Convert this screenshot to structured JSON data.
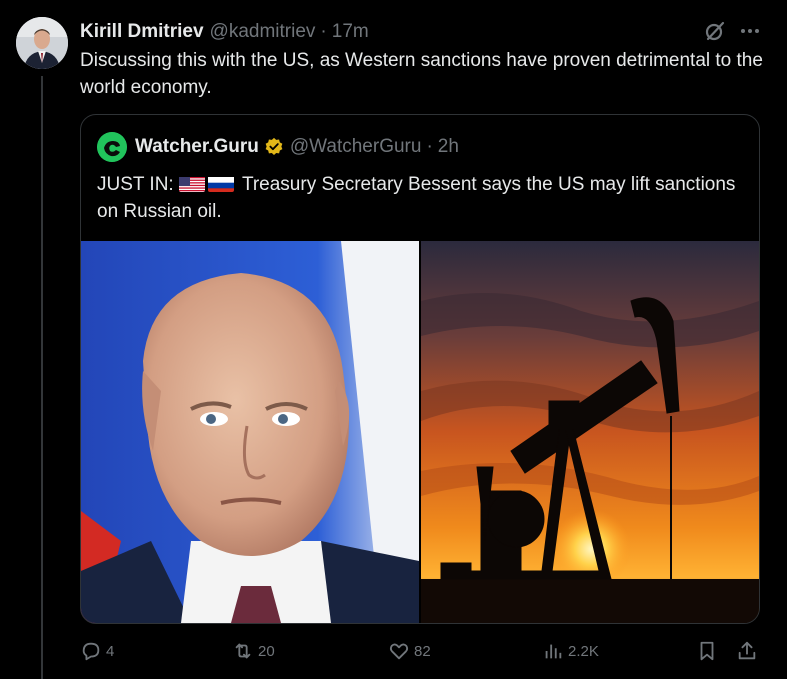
{
  "post": {
    "author_name": "Kirill Dmitriev",
    "author_handle": "@kadmitriev",
    "separator": "·",
    "time": "17m",
    "text": "Discussing this with the US, as Western sanctions have proven detrimental to the world economy."
  },
  "quote": {
    "author_name": "Watcher.Guru",
    "author_handle": "@WatcherGuru",
    "separator": "·",
    "time": "2h",
    "text_prefix": "JUST IN:",
    "text_body": "Treasury Secretary Bessent says the US may lift sanctions on Russian oil.",
    "verified_color": "#e2b719"
  },
  "actions": {
    "replies": "4",
    "reposts": "20",
    "likes": "82",
    "views": "2.2K"
  },
  "colors": {
    "background": "#000000",
    "text": "#e7e9ea",
    "secondary": "#71767b",
    "border": "#2f3336"
  }
}
